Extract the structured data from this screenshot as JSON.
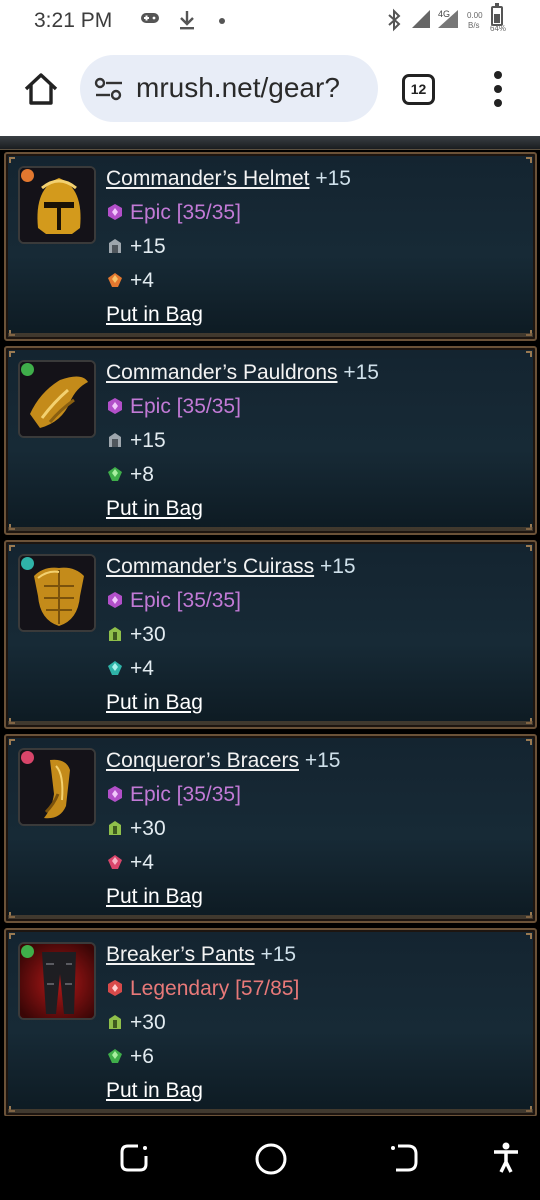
{
  "status_bar": {
    "time": "3:21 PM",
    "network_type": "4G",
    "speed_value": "0.00",
    "speed_unit": "B/s",
    "battery": "64%",
    "icons": [
      "gamepad-icon",
      "download-icon",
      "dot-icon",
      "bluetooth-icon",
      "signal-icon",
      "signal-4g-icon",
      "battery-icon"
    ]
  },
  "browser": {
    "url": "mrush.net/gear?",
    "tab_count": "12",
    "icons": [
      "home-icon",
      "site-settings-icon",
      "tab-switcher-icon",
      "overflow-menu-icon"
    ]
  },
  "items": [
    {
      "name": "Commander’s Helmet",
      "level": "+15",
      "rarity": "Epic [35/35]",
      "rarity_type": "epic",
      "stat1": "+15",
      "stat1_icon": "armor-icon",
      "stat2": "+4",
      "stat2_icon": "orange-gem-icon",
      "action": "Put in Bag",
      "gem_color": "#e3782f",
      "image_icon": "golden-helmet-icon"
    },
    {
      "name": "Commander’s Pauldrons",
      "level": "+15",
      "rarity": "Epic [35/35]",
      "rarity_type": "epic",
      "stat1": "+15",
      "stat1_icon": "armor-icon",
      "stat2": "+8",
      "stat2_icon": "green-gem-icon",
      "action": "Put in Bag",
      "gem_color": "#3fae4a",
      "image_icon": "golden-pauldrons-icon"
    },
    {
      "name": "Commander’s Cuirass",
      "level": "+15",
      "rarity": "Epic [35/35]",
      "rarity_type": "epic",
      "stat1": "+30",
      "stat1_icon": "health-icon",
      "stat2": "+4",
      "stat2_icon": "teal-gem-icon",
      "action": "Put in Bag",
      "gem_color": "#2fb3a8",
      "image_icon": "golden-cuirass-icon"
    },
    {
      "name": "Conqueror’s Bracers",
      "level": "+15",
      "rarity": "Epic [35/35]",
      "rarity_type": "epic",
      "stat1": "+30",
      "stat1_icon": "health-icon",
      "stat2": "+4",
      "stat2_icon": "pink-gem-icon",
      "action": "Put in Bag",
      "gem_color": "#d8456a",
      "image_icon": "golden-bracers-icon"
    },
    {
      "name": "Breaker’s Pants",
      "level": "+15",
      "rarity": "Legendary [57/85]",
      "rarity_type": "legendary",
      "stat1": "+30",
      "stat1_icon": "health-icon",
      "stat2": "+6",
      "stat2_icon": "green-gem-icon",
      "action": "Put in Bag",
      "gem_color": "#3fae4a",
      "image_icon": "red-pants-icon"
    }
  ],
  "colors": {
    "epic": "#c27ad6",
    "legendary": "#e87979",
    "card_border": "#6b5238"
  },
  "nav_bar": {
    "icons": [
      "recents-icon",
      "home-circle-icon",
      "back-icon",
      "accessibility-icon"
    ]
  }
}
